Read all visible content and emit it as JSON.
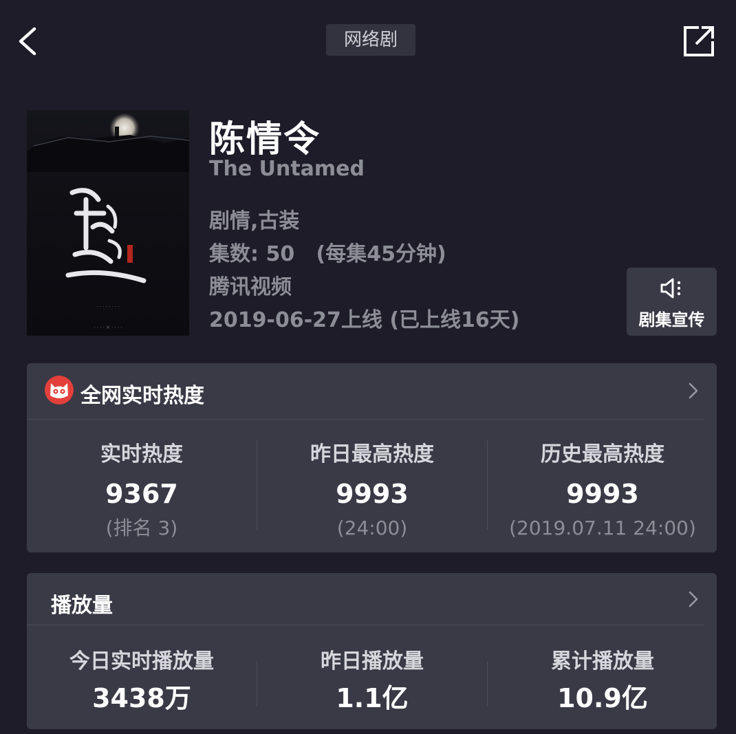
{
  "header": {
    "tag": "网络剧"
  },
  "show": {
    "title": "陈情令",
    "english_title": "The Untamed",
    "genre": "剧情,古装",
    "episodes": "集数: 50   (每集45分钟)",
    "platform": "腾讯视频",
    "release": "2019-06-27上线 (已上线16天)"
  },
  "promo": {
    "label": "剧集宣传",
    "icon": "speaker-icon"
  },
  "heat": {
    "title": "全网实时热度",
    "icon": "maoyan-cat-icon",
    "stats": [
      {
        "label": "实时热度",
        "value": "9367",
        "note": "(排名 3)"
      },
      {
        "label": "昨日最高热度",
        "value": "9993",
        "note": "(24:00)"
      },
      {
        "label": "历史最高热度",
        "value": "9993",
        "note": "(2019.07.11 24:00)"
      }
    ]
  },
  "plays": {
    "title": "播放量",
    "stats": [
      {
        "label": "今日实时播放量",
        "value": "3438万"
      },
      {
        "label": "昨日播放量",
        "value": "1.1亿"
      },
      {
        "label": "累计播放量",
        "value": "10.9亿"
      }
    ]
  },
  "colors": {
    "background": "#1d1c28",
    "card": "#3a3946",
    "muted_text": "#8d8d97",
    "brand_red": "#e4403b"
  }
}
